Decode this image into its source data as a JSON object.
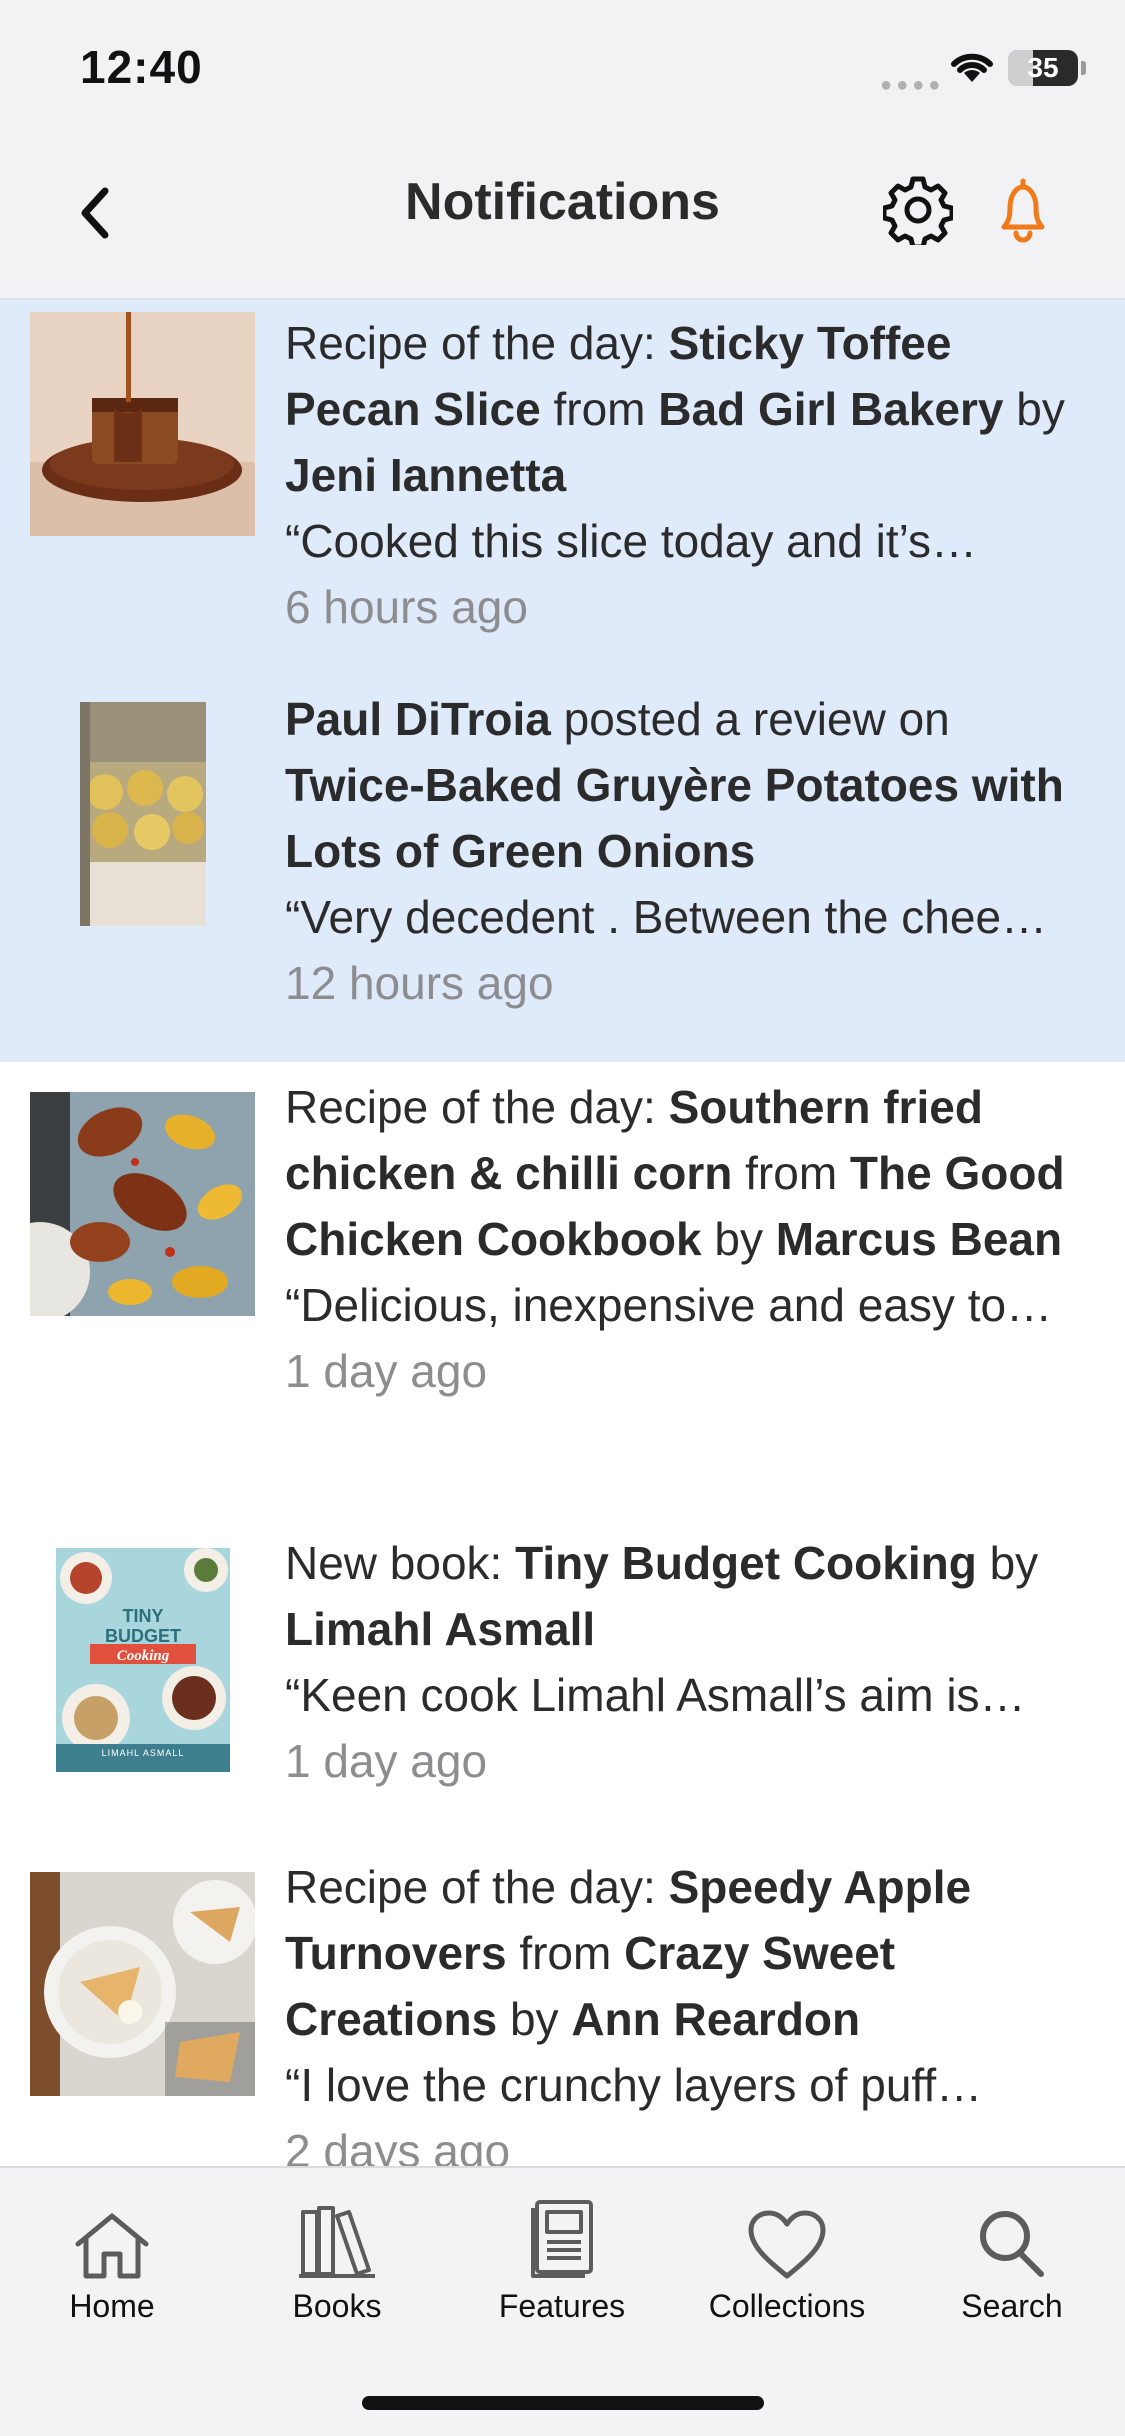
{
  "status_bar": {
    "time": "12:40",
    "battery_percent": 35,
    "battery_label": "35"
  },
  "header": {
    "title": "Notifications",
    "back_icon": "chevron-left-icon",
    "settings_icon": "gear-icon",
    "bell_icon": "bell-icon",
    "bell_color": "#f07a1a"
  },
  "notifications": [
    {
      "unread": true,
      "thumb": "sticky-toffee-pecan-slice",
      "parts": [
        {
          "t": "Recipe of the day: ",
          "b": false
        },
        {
          "t": "Sticky Toffee Pecan Slice",
          "b": true
        },
        {
          "t": " from ",
          "b": false
        },
        {
          "t": "Bad Girl Bakery",
          "b": true
        },
        {
          "t": " by ",
          "b": false
        },
        {
          "t": "Jeni Iannetta",
          "b": true
        }
      ],
      "quote": "“Cooked this slice today and it’s…",
      "time": "6 hours ago"
    },
    {
      "unread": true,
      "thumb": "twice-baked-potatoes",
      "parts": [
        {
          "t": "Paul DiTroia",
          "b": true
        },
        {
          "t": " posted a review on ",
          "b": false
        },
        {
          "t": "Twice-Baked Gruyère Potatoes with Lots of Green Onions",
          "b": true
        }
      ],
      "quote": "“Very decedent . Between the chee…",
      "time": "12 hours ago"
    },
    {
      "unread": false,
      "thumb": "southern-fried-chicken",
      "parts": [
        {
          "t": "Recipe of the day: ",
          "b": false
        },
        {
          "t": "Southern fried chicken & chilli corn",
          "b": true
        },
        {
          "t": " from ",
          "b": false
        },
        {
          "t": "The Good Chicken Cookbook",
          "b": true
        },
        {
          "t": " by ",
          "b": false
        },
        {
          "t": "Marcus Bean",
          "b": true
        }
      ],
      "quote": "“Delicious, inexpensive and easy to…",
      "time": "1 day ago"
    },
    {
      "unread": false,
      "thumb": "tiny-budget-cooking-cover",
      "parts": [
        {
          "t": "New book: ",
          "b": false
        },
        {
          "t": "Tiny Budget Cooking",
          "b": true
        },
        {
          "t": " by ",
          "b": false
        },
        {
          "t": "Limahl Asmall",
          "b": true
        }
      ],
      "quote": "“Keen cook Limahl Asmall’s aim is…",
      "time": "1 day ago"
    },
    {
      "unread": false,
      "thumb": "speedy-apple-turnovers",
      "parts": [
        {
          "t": "Recipe of the day: ",
          "b": false
        },
        {
          "t": "Speedy Apple Turnovers",
          "b": true
        },
        {
          "t": " from ",
          "b": false
        },
        {
          "t": "Crazy Sweet Creations",
          "b": true
        },
        {
          "t": " by ",
          "b": false
        },
        {
          "t": "Ann Reardon",
          "b": true
        }
      ],
      "quote": "“I love the crunchy layers of puff…",
      "time": "2 days ago"
    }
  ],
  "book_cover": {
    "title_line1": "TINY",
    "title_line2": "BUDGET",
    "title_line3": "Cooking",
    "author": "LIMAHL ASMALL"
  },
  "tab_bar": {
    "tabs": [
      {
        "label": "Home",
        "icon": "home-icon"
      },
      {
        "label": "Books",
        "icon": "books-icon"
      },
      {
        "label": "Features",
        "icon": "features-icon"
      },
      {
        "label": "Collections",
        "icon": "heart-icon"
      },
      {
        "label": "Search",
        "icon": "search-icon"
      }
    ]
  }
}
